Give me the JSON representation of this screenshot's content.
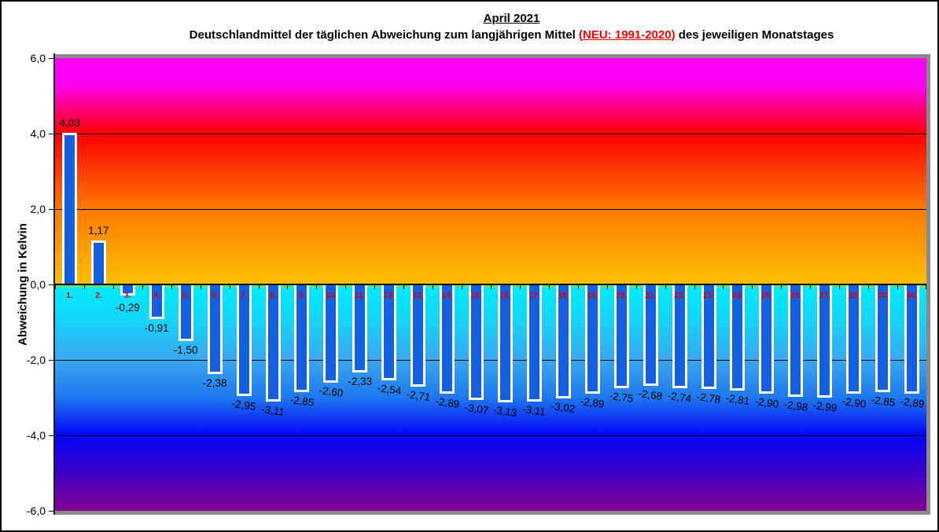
{
  "title": {
    "line1": "April 2021",
    "sub_before": "Deutschlandmittel der täglichen Abweichung zum langjährigen Mittel ",
    "sub_open": "(",
    "sub_highlight": "NEU: 1991-2020",
    "sub_close": ")",
    "sub_after": " des jeweiligen Monatstages"
  },
  "chart_data": {
    "type": "bar",
    "title": "April 2021",
    "subtitle": "Deutschlandmittel der täglichen Abweichung zum langjährigen Mittel (NEU: 1991-2020) des jeweiligen Monatstages",
    "xlabel": "",
    "ylabel": "Abweichung in Kelvin",
    "ylim": [
      -6.0,
      6.0
    ],
    "ytick_step": 2.0,
    "ytick_labels": [
      "6,0",
      "4,0",
      "2,0",
      "0,0",
      "-2,0",
      "-4,0",
      "-6,0"
    ],
    "gridlines_at": [
      4.0,
      2.0,
      -2.0,
      -4.0
    ],
    "grid": true,
    "legend": false,
    "categories": [
      "1.",
      "2.",
      "3.",
      "4.",
      "5.",
      "6.",
      "7.",
      "8.",
      "9.",
      "10.",
      "11.",
      "12.",
      "13.",
      "14.",
      "15.",
      "16.",
      "17.",
      "18.",
      "19.",
      "20.",
      "21.",
      "22.",
      "23.",
      "24.",
      "25.",
      "26.",
      "27.",
      "28.",
      "29.",
      "30."
    ],
    "values": [
      4.03,
      1.17,
      -0.29,
      -0.91,
      -1.5,
      -2.38,
      -2.95,
      -3.11,
      -2.85,
      -2.6,
      -2.33,
      -2.54,
      -2.71,
      -2.89,
      -3.07,
      -3.13,
      -3.11,
      -3.02,
      -2.89,
      -2.75,
      -2.68,
      -2.74,
      -2.78,
      -2.81,
      -2.9,
      -2.98,
      -2.99,
      -2.9,
      -2.85,
      -2.89
    ],
    "value_labels": [
      "4,03",
      "1,17",
      "-0,29",
      "-0,91",
      "-1,50",
      "-2,38",
      "-2,95",
      "-3,11",
      "-2,85",
      "-2,60",
      "-2,33",
      "-2,54",
      "-2,71",
      "-2,89",
      "-3,07",
      "-3,13",
      "-3,11",
      "-3,02",
      "-2,89",
      "-2,75",
      "-2,68",
      "-2,74",
      "-2,78",
      "-2,81",
      "-2,90",
      "-2,98",
      "-2,99",
      "-2,90",
      "-2,85",
      "-2,89"
    ],
    "colors": {
      "bar_fill": "#135fe0",
      "bar_border": "#ffffff",
      "day_label": "#e00000",
      "highlight_red": "#ff0000",
      "gridline": "#000000",
      "plot_shadow": "#8a8a8a",
      "gradient_top": "#ff00ff",
      "gradient_red": "#ff0000",
      "gradient_amber": "#fdbd01",
      "gradient_cyan": "#00eaff",
      "gradient_blue": "#0504fa",
      "gradient_bottom": "#850090"
    }
  }
}
